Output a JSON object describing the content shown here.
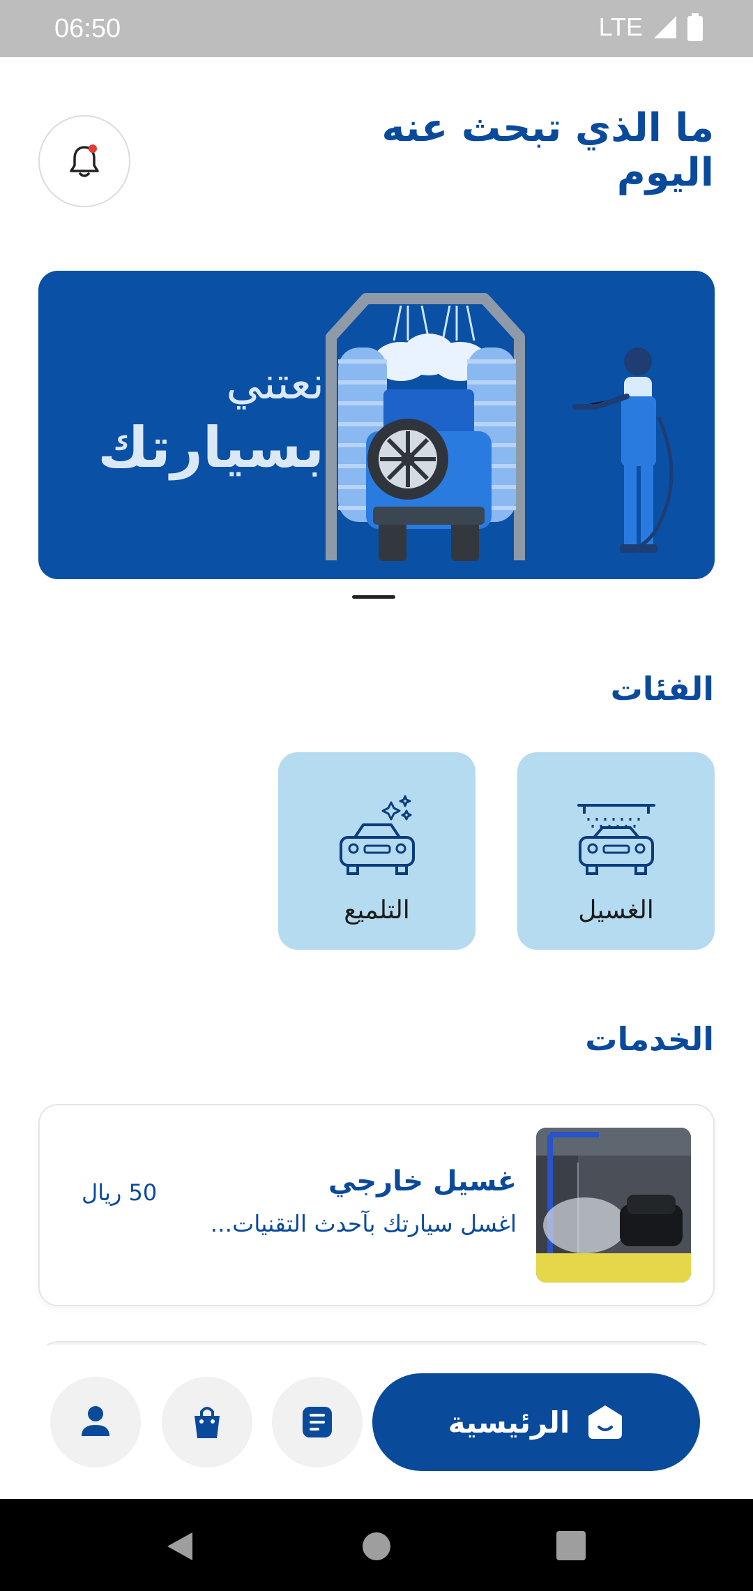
{
  "status_bar": {
    "time": "06:50",
    "network": "LTE"
  },
  "header": {
    "title": "ما الذي تبحث عنه اليوم"
  },
  "banner": {
    "line1": "نعتني",
    "line2": "بسيارتك"
  },
  "categories": {
    "title": "الفئات",
    "items": [
      {
        "label": "الغسيل",
        "icon": "car-wash-icon"
      },
      {
        "label": "التلميع",
        "icon": "car-polish-icon"
      }
    ]
  },
  "services": {
    "title": "الخدمات",
    "items": [
      {
        "title": "غسيل خارجي",
        "description": "اغسل سيارتك بآحدث التقنيات...",
        "price": "50 ريال"
      }
    ]
  },
  "bottom_nav": {
    "home_label": "الرئيسية"
  },
  "colors": {
    "primary": "#0a4a9b",
    "category_bg": "#b5dbf0",
    "banner_bg": "#0a50a5"
  }
}
